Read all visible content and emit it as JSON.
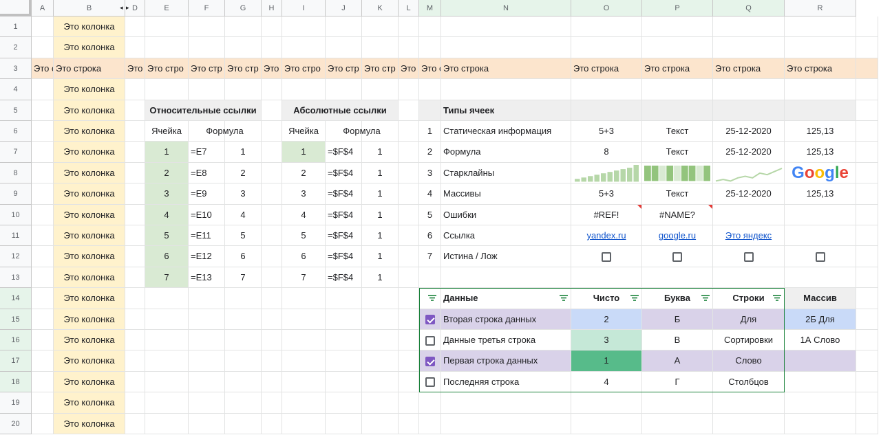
{
  "columns": [
    "A",
    "B",
    "D",
    "E",
    "F",
    "G",
    "H",
    "I",
    "J",
    "K",
    "L",
    "M",
    "N",
    "O",
    "P",
    "Q",
    "R"
  ],
  "rows": [
    "1",
    "2",
    "3",
    "4",
    "5",
    "6",
    "7",
    "8",
    "9",
    "10",
    "11",
    "12",
    "13",
    "14",
    "15",
    "16",
    "17",
    "18",
    "19",
    "20"
  ],
  "col_b_label": "Это колонка",
  "row3": {
    "a": "Это с",
    "b": "Это строка",
    "d": "Это",
    "e": "Это стро",
    "f": "Это стр",
    "g": "Это стр",
    "h": "Это",
    "i": "Это стро",
    "j": "Это стр",
    "k": "Это стр",
    "l": "Это с",
    "m": "Это с",
    "n": "Это строка",
    "o": "Это строка",
    "p": "Это строка",
    "q": "Это строка",
    "r": "Это строка"
  },
  "relative": {
    "title": "Относительные ссылки",
    "col_cell": "Ячейка",
    "col_formula": "Формула",
    "rows": [
      {
        "cell": "1",
        "formula": "=E7",
        "value": "1"
      },
      {
        "cell": "2",
        "formula": "=E8",
        "value": "2"
      },
      {
        "cell": "3",
        "formula": "=E9",
        "value": "3"
      },
      {
        "cell": "4",
        "formula": "=E10",
        "value": "4"
      },
      {
        "cell": "5",
        "formula": "=E11",
        "value": "5"
      },
      {
        "cell": "6",
        "formula": "=E12",
        "value": "6"
      },
      {
        "cell": "7",
        "formula": "=E13",
        "value": "7"
      }
    ]
  },
  "absolute": {
    "title": "Абсолютные ссылки",
    "col_cell": "Ячейка",
    "col_formula": "Формула",
    "rows": [
      {
        "cell": "1",
        "formula": "=$F$4",
        "value": "1"
      },
      {
        "cell": "2",
        "formula": "=$F$4",
        "value": "1"
      },
      {
        "cell": "3",
        "formula": "=$F$4",
        "value": "1"
      },
      {
        "cell": "4",
        "formula": "=$F$4",
        "value": "1"
      },
      {
        "cell": "5",
        "formula": "=$F$4",
        "value": "1"
      },
      {
        "cell": "6",
        "formula": "=$F$4",
        "value": "1"
      },
      {
        "cell": "7",
        "formula": "=$F$4",
        "value": "1"
      }
    ]
  },
  "types": {
    "title": "Типы ячеек",
    "rows": [
      {
        "n": "1",
        "label": "Статическая информация",
        "o": "5+3",
        "p": "Текст",
        "q": "25-12-2020",
        "r": "125,13"
      },
      {
        "n": "2",
        "label": "Формула",
        "o": "8",
        "p": "Текст",
        "q": "25-12-2020",
        "r": "125,13"
      },
      {
        "n": "3",
        "label": "Старклайны",
        "o": "",
        "p": "",
        "q": "",
        "r": "Google"
      },
      {
        "n": "4",
        "label": "Массивы",
        "o": "5+3",
        "p": "Текст",
        "q": "25-12-2020",
        "r": "125,13"
      },
      {
        "n": "5",
        "label": "Ошибки",
        "o": "#REF!",
        "p": "#NAME?",
        "q": "",
        "r": ""
      },
      {
        "n": "6",
        "label": "Ссылка",
        "o": "yandex.ru",
        "p": "google.ru",
        "q": "Это яндекс",
        "r": ""
      },
      {
        "n": "7",
        "label": "Истина / Лож",
        "o": "",
        "p": "",
        "q": "",
        "r": ""
      }
    ]
  },
  "sparklines": {
    "bars": [
      2,
      3,
      4,
      5,
      6,
      7,
      8,
      9,
      10,
      12
    ],
    "winloss": [
      1,
      1,
      0,
      1,
      0,
      1,
      1,
      0,
      1
    ],
    "line": [
      3,
      4,
      3,
      5,
      6,
      5,
      8,
      7,
      9,
      11
    ]
  },
  "colors": {
    "google_blue": "#4285f4",
    "google_red": "#ea4335",
    "google_yellow": "#fbbc05",
    "google_green": "#34a853",
    "spark_bar": "#b6d7a8",
    "spark_win": "#93c47d",
    "spark_line": "#b6d7a8"
  },
  "table": {
    "headers": {
      "data": "Данные",
      "clean": "Чисто",
      "letter": "Буква",
      "strings": "Строки",
      "array": "Массив"
    },
    "rows": [
      {
        "checked": true,
        "data": "Вторая строка данных",
        "clean": "2",
        "letter": "Б",
        "strings": "Для",
        "array": "2Б Для"
      },
      {
        "checked": false,
        "data": "Данные третья строка",
        "clean": "3",
        "letter": "В",
        "strings": "Сортировки",
        "array": "1А Слово"
      },
      {
        "checked": true,
        "data": "Первая строка данных",
        "clean": "1",
        "letter": "А",
        "strings": "Слово",
        "array": ""
      },
      {
        "checked": false,
        "data": "Последняя строка",
        "clean": "4",
        "letter": "Г",
        "strings": "Столбцов",
        "array": ""
      }
    ]
  }
}
